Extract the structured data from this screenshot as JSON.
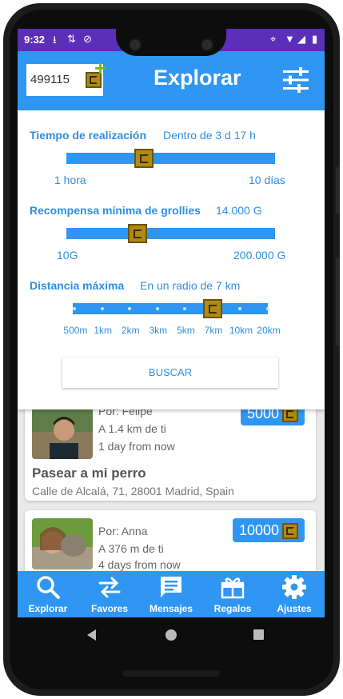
{
  "status": {
    "time": "9:32"
  },
  "header": {
    "balance": "499115",
    "title": "Explorar",
    "plus": "+"
  },
  "filters": {
    "time": {
      "label": "Tiempo de realización",
      "value": "Dentro de 3 d  17 h",
      "min": "1 hora",
      "max": "10 días",
      "level": 0.37
    },
    "reward": {
      "label": "Recompensa mínima de grollies",
      "value": "14.000 G",
      "min": "10G",
      "max": "200.000 G",
      "level": 0.34
    },
    "distance": {
      "label": "Distancia máxima",
      "value": "En un radio de 7 km",
      "ticks": [
        "500m",
        "1km",
        "2km",
        "3km",
        "5km",
        "7km",
        "10km",
        "20km"
      ],
      "selected_index": 5
    },
    "search_label": "BUSCAR"
  },
  "cards": [
    {
      "by": "Por: Felipe",
      "distance": "A 1.4 km de ti",
      "when": "1 day from now",
      "reward": "5000",
      "title": "Pasear a mi perro",
      "address": "Calle de Alcalá, 71, 28001 Madrid, Spain"
    },
    {
      "by": "Por: Anna",
      "distance": "A 376 m de ti",
      "when": "4 days from now",
      "reward": "10000"
    }
  ],
  "nav": [
    {
      "label": "Explorar",
      "icon": "search-icon"
    },
    {
      "label": "Favores",
      "icon": "swap-icon"
    },
    {
      "label": "Mensajes",
      "icon": "message-icon"
    },
    {
      "label": "Regalos",
      "icon": "gift-icon"
    },
    {
      "label": "Ajustes",
      "icon": "gear-icon"
    }
  ],
  "colors": {
    "primary": "#2f96f3",
    "statusbar": "#5c2fb8",
    "coin": "#b08a12",
    "plus": "#6fbf1a"
  }
}
